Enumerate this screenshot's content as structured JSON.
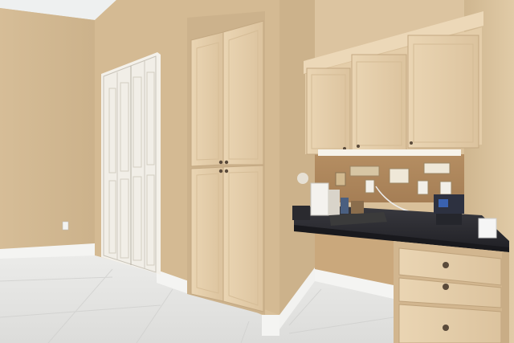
{
  "scene": {
    "subject": "kitchen-desk-nook-with-pantry-cabinets",
    "colors": {
      "wall": "#d8bf98",
      "wall_shadow": "#c9ad86",
      "ceiling": "#eef0f0",
      "cabinet": "#e8d2b0",
      "cabinet_shadow": "#cdb38d",
      "countertop": "#2b2b30",
      "floor": "#e4e4e2",
      "baseboard": "#f4f4f2",
      "door": "#f3f1ec",
      "knob": "#5a4a3a"
    }
  }
}
